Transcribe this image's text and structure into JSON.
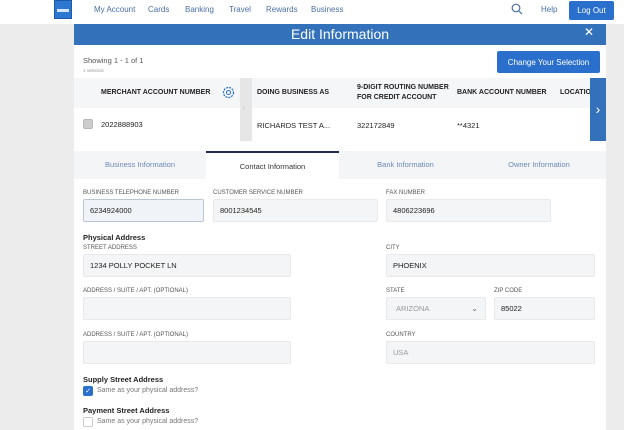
{
  "nav": {
    "items": [
      "My Account",
      "Cards",
      "Banking",
      "Travel",
      "Rewards",
      "Business"
    ],
    "help": "Help",
    "logout": "Log Out"
  },
  "modal": {
    "title": "Edit Information",
    "close": "✕",
    "showing": "Showing 1 - 1 of 1",
    "selected": "1 selected",
    "change_button": "Change Your Selection"
  },
  "table": {
    "headers": [
      "MERCHANT ACCOUNT NUMBER",
      "DOING BUSINESS AS",
      "9-DIGIT ROUTING NUMBER FOR CREDIT ACCOUNT",
      "BANK ACCOUNT NUMBER",
      "LOCATION"
    ],
    "row": {
      "merchant": "2022888903",
      "dba": "RICHARDS TEST A...",
      "routing": "322172849",
      "bank": "**4321"
    }
  },
  "tabs": [
    {
      "label": "Business Information"
    },
    {
      "label": "Contact Information",
      "active": true
    },
    {
      "label": "Bank Information"
    },
    {
      "label": "Owner Information"
    }
  ],
  "form": {
    "btn_label": "BUSINESS TELEPHONE NUMBER",
    "btn_value": "6234924000",
    "csn_label": "CUSTOMER SERVICE NUMBER",
    "csn_value": "8001234545",
    "fax_label": "FAX NUMBER",
    "fax_value": "4806223696",
    "physical": "Physical Address",
    "street_label": "STREET ADDRESS",
    "street_value": "1234 POLLY POCKET LN",
    "city_label": "CITY",
    "city_value": "PHOENIX",
    "addr2_label": "ADDRESS / SUITE / APT. (OPTIONAL)",
    "addr2_value": "",
    "state_label": "STATE",
    "state_value": "ARIZONA",
    "zip_label": "ZIP CODE",
    "zip_value": "85022",
    "addr3_label": "ADDRESS / SUITE / APT. (OPTIONAL)",
    "addr3_value": "",
    "country_label": "COUNTRY",
    "country_value": "USA",
    "supply": "Supply Street Address",
    "supply_same": "Same as your physical address?",
    "supply_checked": true,
    "payment": "Payment Street Address",
    "payment_same": "Same as your physical address?",
    "payment_checked": false
  },
  "colors": {
    "brand": "#3372ba",
    "button": "#2a6fcb"
  }
}
